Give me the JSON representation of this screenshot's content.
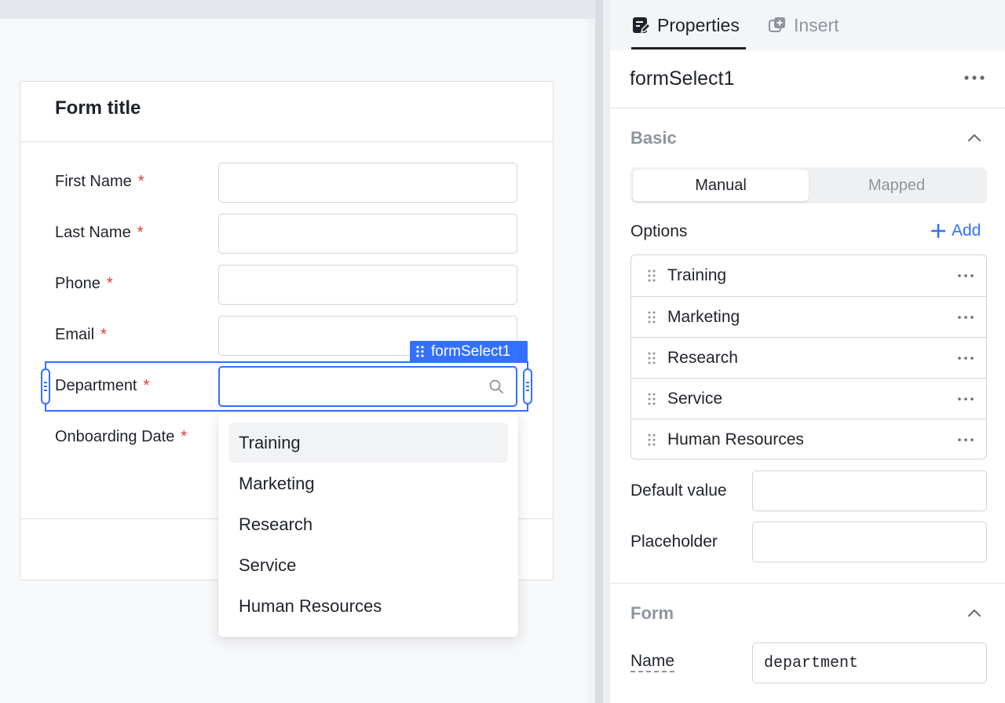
{
  "canvas": {
    "form": {
      "title": "Form title",
      "fields": [
        {
          "label": "First Name",
          "required_mark": "*"
        },
        {
          "label": "Last Name",
          "required_mark": "*"
        },
        {
          "label": "Phone",
          "required_mark": "*"
        },
        {
          "label": "Email",
          "required_mark": "*"
        },
        {
          "label": "Department",
          "required_mark": "*"
        },
        {
          "label": "Onboarding Date",
          "required_mark": "*"
        }
      ]
    },
    "selected_component": {
      "tag": "formSelect1"
    },
    "dropdown": {
      "options": [
        "Training",
        "Marketing",
        "Research",
        "Service",
        "Human Resources"
      ],
      "highlighted": "Training"
    }
  },
  "panel": {
    "tabs": [
      {
        "label": "Properties",
        "icon": "edit-form-icon",
        "active": true
      },
      {
        "label": "Insert",
        "icon": "add-square-icon",
        "active": false
      }
    ],
    "component_name": "formSelect1",
    "basic": {
      "title": "Basic",
      "mode_options": [
        "Manual",
        "Mapped"
      ],
      "selected_mode": "Manual",
      "options_label": "Options",
      "add_label": "Add",
      "options": [
        "Training",
        "Marketing",
        "Research",
        "Service",
        "Human Resources"
      ],
      "default_value_label": "Default value",
      "default_value": "",
      "placeholder_label": "Placeholder",
      "placeholder": ""
    },
    "form_section": {
      "title": "Form",
      "name_label": "Name",
      "name_value": "department"
    }
  },
  "colors": {
    "accent": "#3370ff",
    "required": "#e5372f",
    "muted_text": "#8f959e"
  }
}
